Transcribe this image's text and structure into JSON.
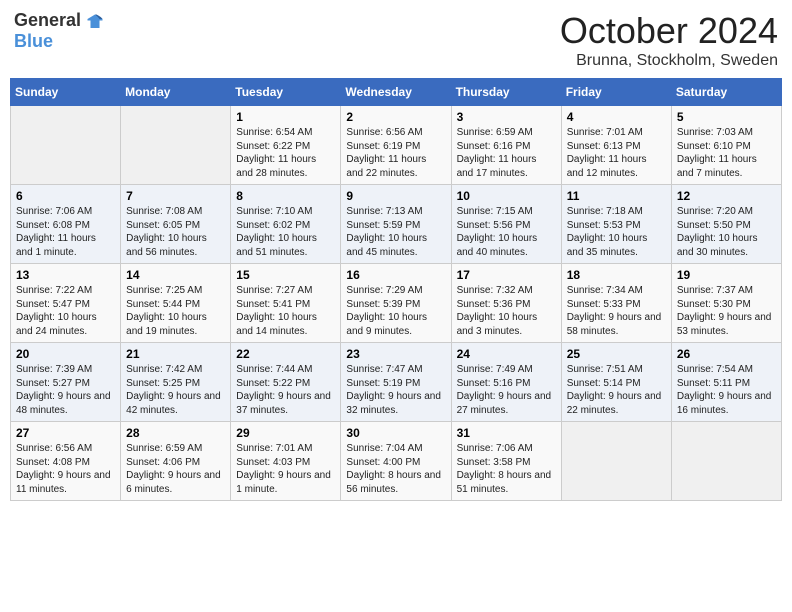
{
  "header": {
    "logo_general": "General",
    "logo_blue": "Blue",
    "month_title": "October 2024",
    "subtitle": "Brunna, Stockholm, Sweden"
  },
  "weekdays": [
    "Sunday",
    "Monday",
    "Tuesday",
    "Wednesday",
    "Thursday",
    "Friday",
    "Saturday"
  ],
  "weeks": [
    [
      {
        "day": "",
        "info": ""
      },
      {
        "day": "",
        "info": ""
      },
      {
        "day": "1",
        "info": "Sunrise: 6:54 AM\nSunset: 6:22 PM\nDaylight: 11 hours and 28 minutes."
      },
      {
        "day": "2",
        "info": "Sunrise: 6:56 AM\nSunset: 6:19 PM\nDaylight: 11 hours and 22 minutes."
      },
      {
        "day": "3",
        "info": "Sunrise: 6:59 AM\nSunset: 6:16 PM\nDaylight: 11 hours and 17 minutes."
      },
      {
        "day": "4",
        "info": "Sunrise: 7:01 AM\nSunset: 6:13 PM\nDaylight: 11 hours and 12 minutes."
      },
      {
        "day": "5",
        "info": "Sunrise: 7:03 AM\nSunset: 6:10 PM\nDaylight: 11 hours and 7 minutes."
      }
    ],
    [
      {
        "day": "6",
        "info": "Sunrise: 7:06 AM\nSunset: 6:08 PM\nDaylight: 11 hours and 1 minute."
      },
      {
        "day": "7",
        "info": "Sunrise: 7:08 AM\nSunset: 6:05 PM\nDaylight: 10 hours and 56 minutes."
      },
      {
        "day": "8",
        "info": "Sunrise: 7:10 AM\nSunset: 6:02 PM\nDaylight: 10 hours and 51 minutes."
      },
      {
        "day": "9",
        "info": "Sunrise: 7:13 AM\nSunset: 5:59 PM\nDaylight: 10 hours and 45 minutes."
      },
      {
        "day": "10",
        "info": "Sunrise: 7:15 AM\nSunset: 5:56 PM\nDaylight: 10 hours and 40 minutes."
      },
      {
        "day": "11",
        "info": "Sunrise: 7:18 AM\nSunset: 5:53 PM\nDaylight: 10 hours and 35 minutes."
      },
      {
        "day": "12",
        "info": "Sunrise: 7:20 AM\nSunset: 5:50 PM\nDaylight: 10 hours and 30 minutes."
      }
    ],
    [
      {
        "day": "13",
        "info": "Sunrise: 7:22 AM\nSunset: 5:47 PM\nDaylight: 10 hours and 24 minutes."
      },
      {
        "day": "14",
        "info": "Sunrise: 7:25 AM\nSunset: 5:44 PM\nDaylight: 10 hours and 19 minutes."
      },
      {
        "day": "15",
        "info": "Sunrise: 7:27 AM\nSunset: 5:41 PM\nDaylight: 10 hours and 14 minutes."
      },
      {
        "day": "16",
        "info": "Sunrise: 7:29 AM\nSunset: 5:39 PM\nDaylight: 10 hours and 9 minutes."
      },
      {
        "day": "17",
        "info": "Sunrise: 7:32 AM\nSunset: 5:36 PM\nDaylight: 10 hours and 3 minutes."
      },
      {
        "day": "18",
        "info": "Sunrise: 7:34 AM\nSunset: 5:33 PM\nDaylight: 9 hours and 58 minutes."
      },
      {
        "day": "19",
        "info": "Sunrise: 7:37 AM\nSunset: 5:30 PM\nDaylight: 9 hours and 53 minutes."
      }
    ],
    [
      {
        "day": "20",
        "info": "Sunrise: 7:39 AM\nSunset: 5:27 PM\nDaylight: 9 hours and 48 minutes."
      },
      {
        "day": "21",
        "info": "Sunrise: 7:42 AM\nSunset: 5:25 PM\nDaylight: 9 hours and 42 minutes."
      },
      {
        "day": "22",
        "info": "Sunrise: 7:44 AM\nSunset: 5:22 PM\nDaylight: 9 hours and 37 minutes."
      },
      {
        "day": "23",
        "info": "Sunrise: 7:47 AM\nSunset: 5:19 PM\nDaylight: 9 hours and 32 minutes."
      },
      {
        "day": "24",
        "info": "Sunrise: 7:49 AM\nSunset: 5:16 PM\nDaylight: 9 hours and 27 minutes."
      },
      {
        "day": "25",
        "info": "Sunrise: 7:51 AM\nSunset: 5:14 PM\nDaylight: 9 hours and 22 minutes."
      },
      {
        "day": "26",
        "info": "Sunrise: 7:54 AM\nSunset: 5:11 PM\nDaylight: 9 hours and 16 minutes."
      }
    ],
    [
      {
        "day": "27",
        "info": "Sunrise: 6:56 AM\nSunset: 4:08 PM\nDaylight: 9 hours and 11 minutes."
      },
      {
        "day": "28",
        "info": "Sunrise: 6:59 AM\nSunset: 4:06 PM\nDaylight: 9 hours and 6 minutes."
      },
      {
        "day": "29",
        "info": "Sunrise: 7:01 AM\nSunset: 4:03 PM\nDaylight: 9 hours and 1 minute."
      },
      {
        "day": "30",
        "info": "Sunrise: 7:04 AM\nSunset: 4:00 PM\nDaylight: 8 hours and 56 minutes."
      },
      {
        "day": "31",
        "info": "Sunrise: 7:06 AM\nSunset: 3:58 PM\nDaylight: 8 hours and 51 minutes."
      },
      {
        "day": "",
        "info": ""
      },
      {
        "day": "",
        "info": ""
      }
    ]
  ]
}
